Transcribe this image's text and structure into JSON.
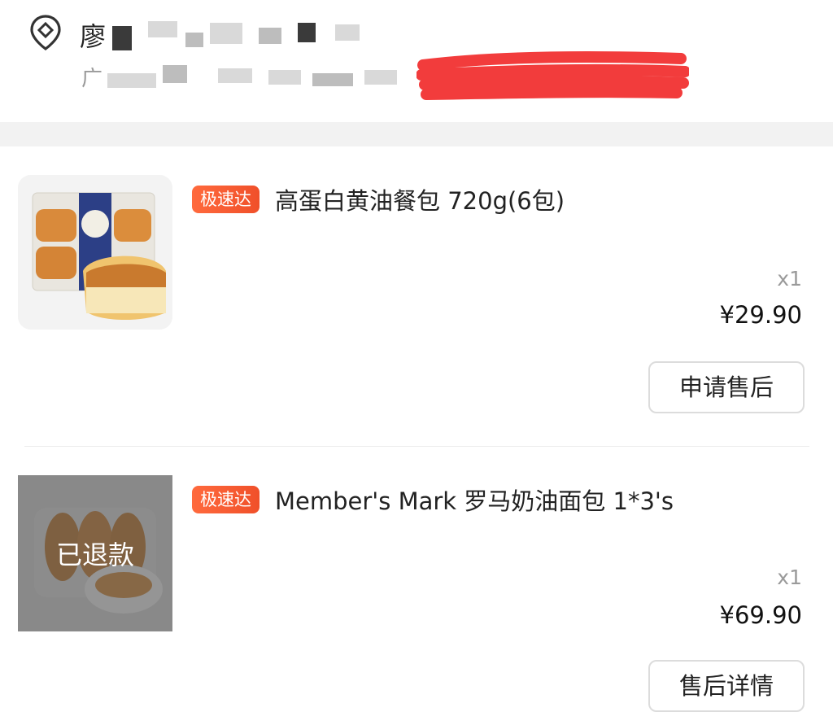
{
  "address": {
    "name": "廖",
    "line": "广"
  },
  "orders": [
    {
      "badge": "极速达",
      "title": "高蛋白黄油餐包 720g(6包)",
      "qty": "x1",
      "price": "¥29.90",
      "action": "申请售后",
      "refund_label": ""
    },
    {
      "badge": "极速达",
      "title": "Member's Mark 罗马奶油面包 1*3's",
      "qty": "x1",
      "price": "¥69.90",
      "action": "售后详情",
      "refund_label": "已退款"
    }
  ],
  "colors": {
    "badge": "#f0502a",
    "redaction": "#f23c3c"
  }
}
